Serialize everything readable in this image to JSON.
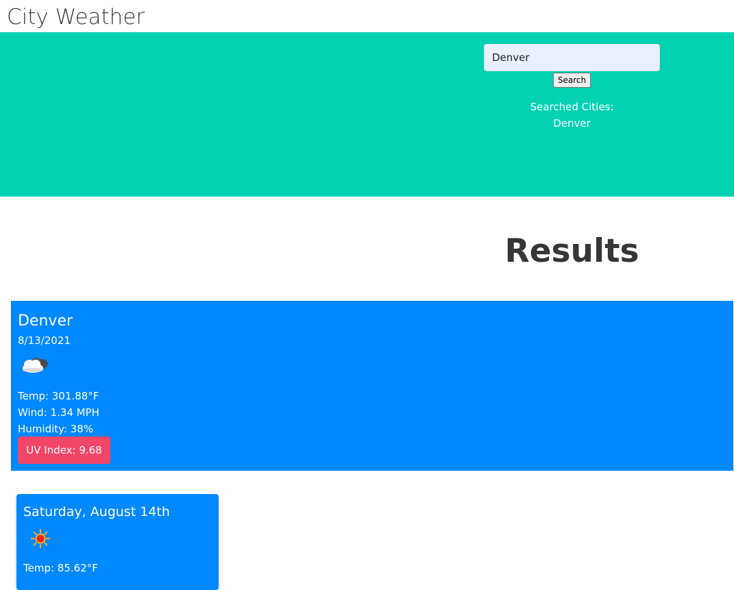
{
  "app": {
    "title": "City Weather"
  },
  "search": {
    "value": "Denver",
    "button_label": "Search"
  },
  "history": {
    "label": "Searched Cities:",
    "cities": [
      "Denver"
    ]
  },
  "results": {
    "heading": "Results"
  },
  "current": {
    "city": "Denver",
    "date": "8/13/2021",
    "icon": "cloudy-icon",
    "temp": "Temp: 301.88°F",
    "wind": "Wind: 1.34 MPH",
    "humidity": "Humidity: 38%",
    "uv": "UV Index: 9.68"
  },
  "forecast": [
    {
      "day": "Saturday, August 14th",
      "icon": "sun-icon",
      "temp": "Temp: 85.62°F"
    }
  ],
  "colors": {
    "hero": "#00d1b2",
    "panel": "#0088ff",
    "uv_badge": "#f14668"
  }
}
